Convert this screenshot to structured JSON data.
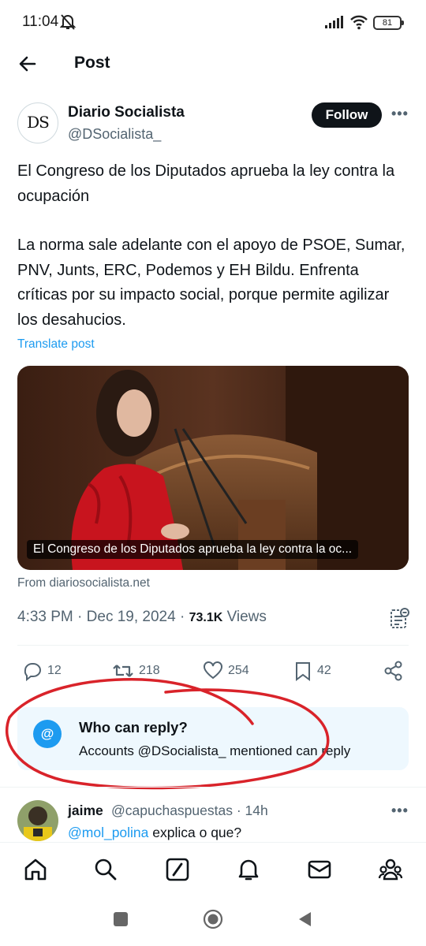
{
  "status_bar": {
    "time": "11:04",
    "battery": "81"
  },
  "header": {
    "title": "Post"
  },
  "author": {
    "avatar_text": "DS",
    "name": "Diario Socialista",
    "handle": "@DSocialista_",
    "follow_label": "Follow"
  },
  "post": {
    "paragraph1": "El Congreso de los Diputados aprueba la ley contra la ocupación",
    "paragraph2": "La norma sale adelante con el apoyo de PSOE, Sumar, PNV, Junts, ERC, Podemos y EH Bildu. Enfrenta críticas por su impacto social, porque permite agilizar los desahucios.",
    "translate_label": "Translate post",
    "card_caption": "El Congreso de los Diputados aprueba la ley contra la oc...",
    "card_source": "From diariosocialista.net"
  },
  "meta": {
    "time": "4:33 PM",
    "date": "Dec 19, 2024",
    "views_count": "73.1K",
    "views_label": "Views"
  },
  "actions": {
    "replies": "12",
    "reposts": "218",
    "likes": "254",
    "bookmarks": "42"
  },
  "who_can_reply": {
    "title": "Who can reply?",
    "subtitle": "Accounts @DSocialista_ mentioned can reply",
    "icon_text": "@"
  },
  "reply": {
    "name": "jaime",
    "handle": "@capuchaspuestas · 14h",
    "mention": "@mol_polina",
    "text": " explica o que?"
  },
  "colors": {
    "accent": "#1d9bf0",
    "text": "#0f1419",
    "muted": "#536471",
    "annotation": "#d9232a"
  },
  "icons": [
    "back-arrow-icon",
    "bell-off-icon",
    "signal-icon",
    "wifi-icon",
    "analytics-icon",
    "reply-icon",
    "repost-icon",
    "like-icon",
    "bookmark-icon",
    "share-icon",
    "home-icon",
    "search-icon",
    "grok-icon",
    "notifications-icon",
    "messages-icon",
    "communities-icon"
  ]
}
